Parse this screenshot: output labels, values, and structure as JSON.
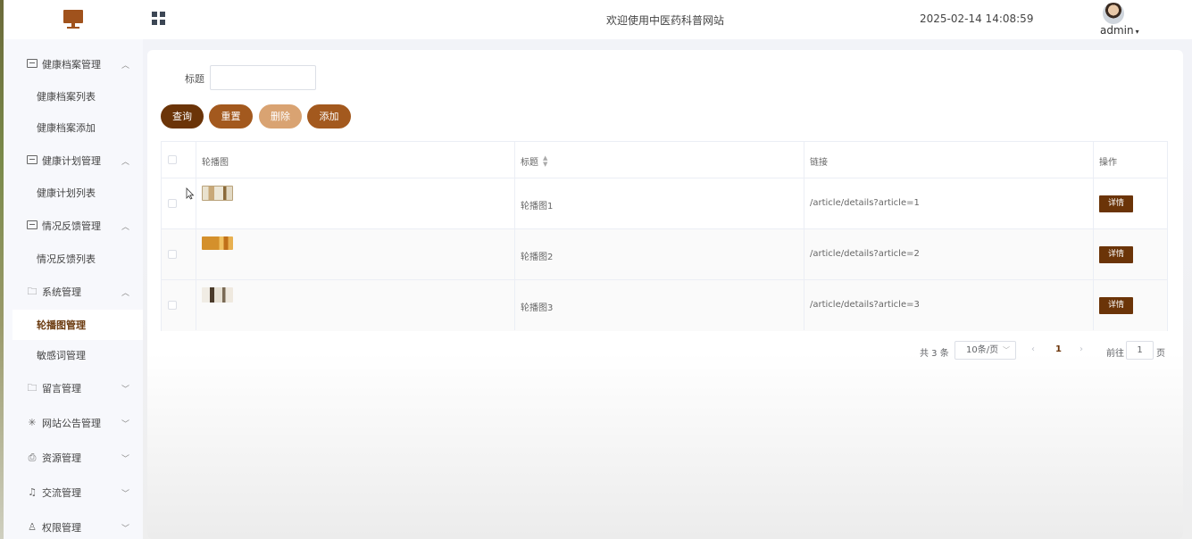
{
  "header": {
    "site_title": "欢迎使用中医药科普网站",
    "datetime": "2025-02-14 14:08:59",
    "username": "admin"
  },
  "sidebar": {
    "groups": [
      {
        "label": "健康档案管理",
        "icon": "document-icon",
        "expanded": true,
        "items": [
          "健康档案列表",
          "健康档案添加"
        ]
      },
      {
        "label": "健康计划管理",
        "icon": "document-icon",
        "expanded": true,
        "items": [
          "健康计划列表"
        ]
      },
      {
        "label": "情况反馈管理",
        "icon": "document-icon",
        "expanded": true,
        "items": [
          "情况反馈列表"
        ]
      },
      {
        "label": "系统管理",
        "icon": "folder-icon",
        "expanded": true,
        "items": [
          "轮播图管理",
          "敏感词管理"
        ]
      },
      {
        "label": "留言管理",
        "icon": "folder-icon",
        "expanded": false,
        "items": []
      },
      {
        "label": "网站公告管理",
        "icon": "loading-icon",
        "expanded": false,
        "items": []
      },
      {
        "label": "资源管理",
        "icon": "printer-icon",
        "expanded": false,
        "items": []
      },
      {
        "label": "交流管理",
        "icon": "headset-icon",
        "expanded": false,
        "items": []
      },
      {
        "label": "权限管理",
        "icon": "user-icon",
        "expanded": false,
        "items": []
      }
    ],
    "active_item": "轮播图管理"
  },
  "search": {
    "title_label": "标题",
    "title_value": "",
    "buttons": {
      "query": "查询",
      "reset": "重置",
      "delete": "删除",
      "add": "添加"
    }
  },
  "table": {
    "columns": {
      "image": "轮播图",
      "title": "标题",
      "link": "链接",
      "actions": "操作"
    },
    "rows": [
      {
        "title": "轮播图1",
        "link": "/article/details?article=1",
        "action": "详情"
      },
      {
        "title": "轮播图2",
        "link": "/article/details?article=2",
        "action": "详情"
      },
      {
        "title": "轮播图3",
        "link": "/article/details?article=3",
        "action": "详情"
      }
    ]
  },
  "pagination": {
    "total": "共 3 条",
    "page_size": "10条/页",
    "current_page": "1",
    "goto_label": "前往",
    "goto_value": "1",
    "page_label": "页"
  },
  "colors": {
    "primary": "#6b3408",
    "secondary": "#a3591e",
    "disabled": "#d9a372",
    "logo": "#a0521c"
  }
}
